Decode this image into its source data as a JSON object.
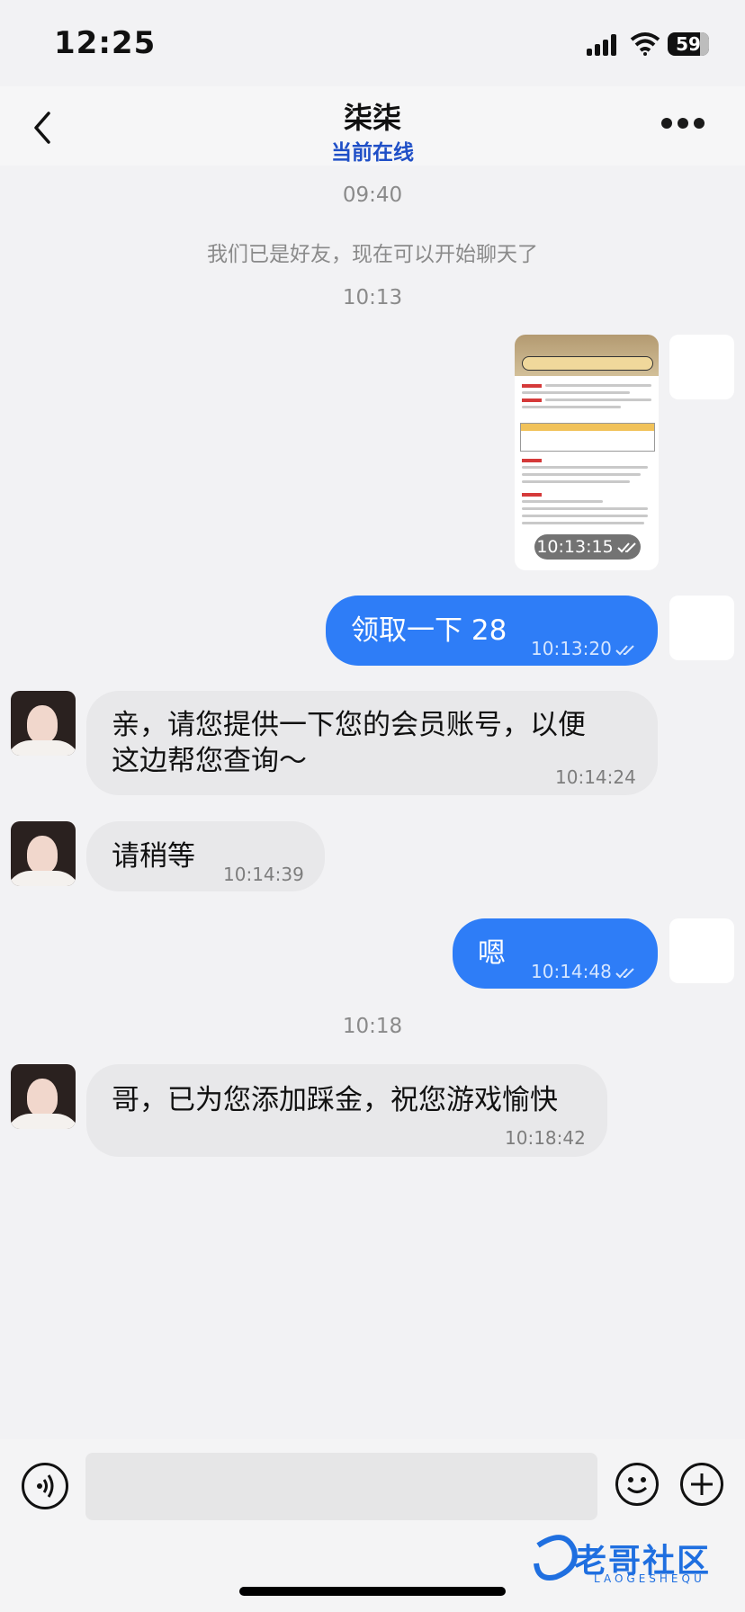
{
  "status_bar": {
    "time": "12:25",
    "battery": "59"
  },
  "header": {
    "title": "柒柒",
    "subtitle": "当前在线"
  },
  "messages": [
    {
      "type": "time",
      "text": "09:40"
    },
    {
      "type": "system",
      "text": "我们已是好友，现在可以开始聊天了"
    },
    {
      "type": "time",
      "text": "10:13"
    },
    {
      "type": "image",
      "direction": "out",
      "time": "10:13:15",
      "status": "read"
    },
    {
      "type": "text",
      "direction": "out",
      "text": "领取一下 28",
      "time": "10:13:20",
      "status": "read"
    },
    {
      "type": "text",
      "direction": "in",
      "text": "亲，请您提供一下您的会员账号，以便这边帮您查询～",
      "line1": "亲，请您提供一下您的会员账号，以便",
      "line2": "这边帮您查询～",
      "time": "10:14:24"
    },
    {
      "type": "text",
      "direction": "in",
      "text": "请稍等",
      "time": "10:14:39"
    },
    {
      "type": "text",
      "direction": "out",
      "text": "嗯",
      "time": "10:14:48",
      "status": "read"
    },
    {
      "type": "time",
      "text": "10:18"
    },
    {
      "type": "text",
      "direction": "in",
      "text": "哥，已为您添加踩金，祝您游戏愉快",
      "time": "10:18:42"
    }
  ],
  "input": {
    "value": "",
    "placeholder": ""
  },
  "icons": {
    "back": "chevron-left-icon",
    "more": "more-horizontal-icon",
    "voice": "voice-icon",
    "emoji": "emoji-icon",
    "plus": "plus-icon",
    "read": "double-check-icon"
  },
  "colors": {
    "outgoing_bubble": "#2e7df7",
    "incoming_bubble": "#e8e8ea",
    "online_status": "#1f4fc7"
  },
  "watermark": {
    "text": "老哥社区",
    "sub": "LAOGESHEQU"
  }
}
